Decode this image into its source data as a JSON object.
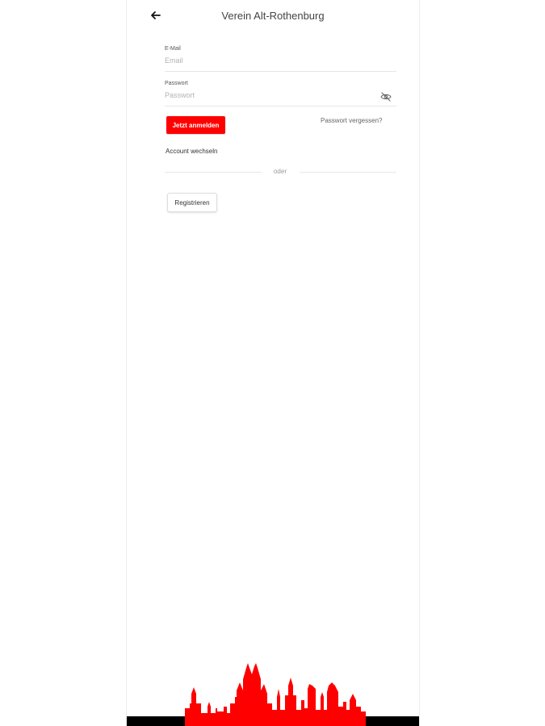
{
  "header": {
    "title": "Verein Alt-Rothenburg",
    "back_icon": "arrow-left-icon"
  },
  "form": {
    "email": {
      "label": "E-Mail",
      "placeholder": "Email",
      "value": ""
    },
    "password": {
      "label": "Passwort",
      "placeholder": "Passwort",
      "value": "",
      "toggle_icon": "eye-off-icon"
    }
  },
  "actions": {
    "login_label": "Jetzt anmelden",
    "forgot_label": "Passwort vergessen?",
    "switch_account_label": "Account wechseln",
    "divider_label": "oder",
    "register_label": "Registrieren"
  },
  "footer": {
    "skyline_icon": "city-skyline-icon"
  },
  "colors": {
    "accent": "#ff0000",
    "text": "#333333",
    "muted": "#999999",
    "border": "#e6e6e6",
    "bar": "#000000"
  }
}
